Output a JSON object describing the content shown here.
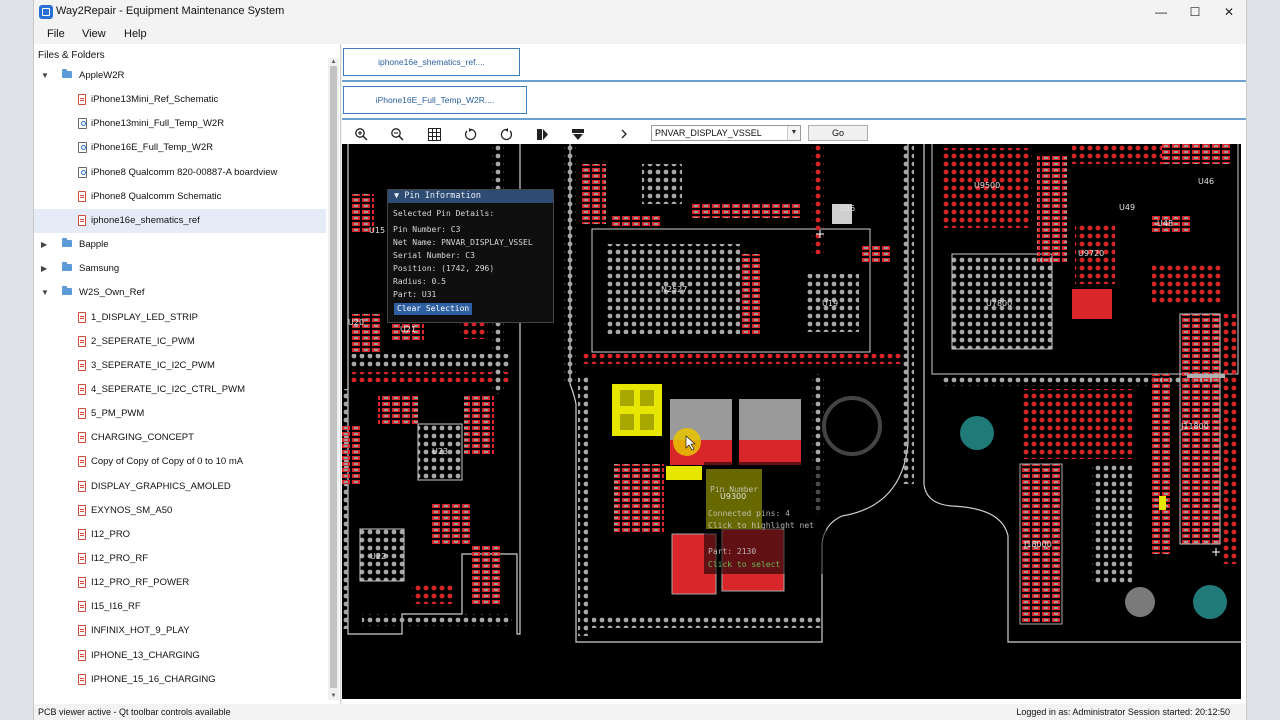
{
  "window": {
    "title": "Way2Repair - Equipment Maintenance System",
    "minimize": "—",
    "maximize": "☐",
    "close": "✕"
  },
  "menu": [
    "File",
    "View",
    "Help"
  ],
  "sidebar": {
    "header": "Files & Folders",
    "tree": [
      {
        "label": "AppleW2R",
        "depth": 0,
        "kind": "folder",
        "expanded": true
      },
      {
        "label": "iPhone13Mini_Ref_Schematic",
        "depth": 1,
        "kind": "pdf"
      },
      {
        "label": "iPhone13mini_Full_Temp_W2R",
        "depth": 1,
        "kind": "boardview"
      },
      {
        "label": "iPhone16E_Full_Temp_W2R",
        "depth": 1,
        "kind": "boardview"
      },
      {
        "label": "iPhone8 Qualcomm 820-00887-A boardview",
        "depth": 1,
        "kind": "boardview"
      },
      {
        "label": "iPhone8 Qualcomm Schematic",
        "depth": 1,
        "kind": "pdf"
      },
      {
        "label": "iphone16e_shematics_ref",
        "depth": 1,
        "kind": "pdf",
        "selected": true
      },
      {
        "label": "Bapple",
        "depth": 0,
        "kind": "folder",
        "expanded": false
      },
      {
        "label": "Samsung",
        "depth": 0,
        "kind": "folder",
        "expanded": false
      },
      {
        "label": "W2S_Own_Ref",
        "depth": 0,
        "kind": "folder",
        "expanded": true
      },
      {
        "label": "1_DISPLAY_LED_STRIP",
        "depth": 1,
        "kind": "pdf"
      },
      {
        "label": "2_SEPERATE_IC_PWM",
        "depth": 1,
        "kind": "pdf"
      },
      {
        "label": "3_SEPERATE_IC_I2C_PWM",
        "depth": 1,
        "kind": "pdf"
      },
      {
        "label": "4_SEPERATE_IC_I2C_CTRL_PWM",
        "depth": 1,
        "kind": "pdf"
      },
      {
        "label": "5_PM_PWM",
        "depth": 1,
        "kind": "pdf"
      },
      {
        "label": "CHARGING_CONCEPT",
        "depth": 1,
        "kind": "pdf"
      },
      {
        "label": "Copy of Copy of Copy of 0 to 10 mA",
        "depth": 1,
        "kind": "pdf"
      },
      {
        "label": "DISPLAY_GRAPHICS_AMOLED",
        "depth": 1,
        "kind": "pdf"
      },
      {
        "label": "EXYNOS_SM_A50",
        "depth": 1,
        "kind": "pdf"
      },
      {
        "label": "I12_PRO",
        "depth": 1,
        "kind": "pdf"
      },
      {
        "label": "I12_PRO_RF",
        "depth": 1,
        "kind": "pdf"
      },
      {
        "label": "I12_PRO_RF_POWER",
        "depth": 1,
        "kind": "pdf"
      },
      {
        "label": "I15_I16_RF",
        "depth": 1,
        "kind": "pdf"
      },
      {
        "label": "INFINIX_HOT_9_PLAY",
        "depth": 1,
        "kind": "pdf"
      },
      {
        "label": "IPHONE_13_CHARGING",
        "depth": 1,
        "kind": "pdf"
      },
      {
        "label": "IPHONE_15_16_CHARGING",
        "depth": 1,
        "kind": "pdf"
      }
    ]
  },
  "tabs": [
    {
      "label": "iphone16e_shematics_ref...."
    },
    {
      "label": "iPhone16E_Full_Temp_W2R...."
    }
  ],
  "toolbar": {
    "icons": [
      "zoom-in-icon",
      "zoom-out-icon",
      "grid-icon",
      "rotate-left-icon",
      "rotate-right-icon",
      "flip-icon",
      "layer-icon",
      "next-icon"
    ],
    "net_value": "PNVAR_DISPLAY_VSSEL",
    "go_label": "Go"
  },
  "pcb": {
    "labels": [
      "U15",
      "U20",
      "U21",
      "U23",
      "U22",
      "N2527",
      "U19",
      "U36",
      "U9500",
      "U46",
      "U49",
      "U48",
      "U9720",
      "U7800",
      "J11800",
      "U9300",
      "J18000"
    ],
    "popup": {
      "title": "▼ Pin Information",
      "header": "Selected Pin Details:",
      "lines": [
        "Pin Number: C3",
        "Net Name: PNVAR_DISPLAY_VSSEL",
        "Serial Number: C3",
        "Position: (1742, 296)",
        "Radius: 0.5",
        "Part: U31"
      ],
      "clear": "Clear Selection"
    },
    "ghost_lines": [
      "Pin Number",
      "Connected pins: 4",
      "Click to highlight net",
      "Part: 2130",
      "Click to select"
    ]
  },
  "status": {
    "left": "PCB viewer active - Qt toolbar controls available",
    "right": "Logged in as: Administrator  Session started: 20:12:50"
  }
}
